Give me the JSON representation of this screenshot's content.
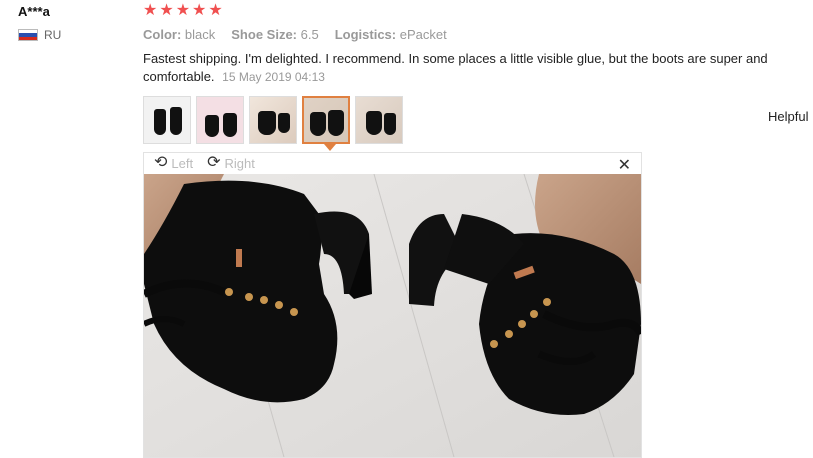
{
  "reviewer": {
    "name": "A***a",
    "country": "RU"
  },
  "rating": {
    "stars": 5,
    "max": 5
  },
  "attributes": [
    {
      "key": "Color:",
      "value": "black"
    },
    {
      "key": "Shoe Size:",
      "value": "6.5"
    },
    {
      "key": "Logistics:",
      "value": "ePacket"
    }
  ],
  "review": {
    "text": "Fastest shipping. I'm delighted. I recommend. In some places a little visible glue, but the boots are super and comfortable.",
    "date": "15 May 2019 04:13"
  },
  "helpful_label": "Helpful",
  "viewer": {
    "left_label": "Left",
    "right_label": "Right",
    "close_icon": "close-icon",
    "active_thumbnail": 4
  },
  "colors": {
    "star": "#f05050",
    "active_border": "#e08040",
    "muted": "#999999"
  }
}
